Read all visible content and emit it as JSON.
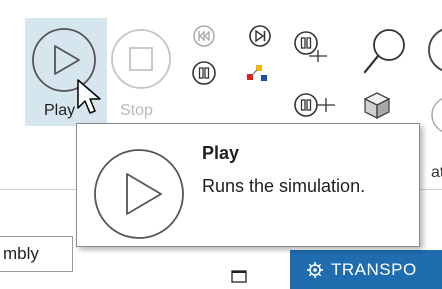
{
  "ribbon": {
    "play_label": "Play",
    "stop_label": "Stop"
  },
  "icons": {
    "play": "play-circle-icon",
    "stop": "stop-circle-icon",
    "jump_start": "jump-to-start-icon",
    "step": "step-forward-icon",
    "pause": "pause-icon",
    "search": "magnifier-icon"
  },
  "tooltip": {
    "title": "Play",
    "description": "Runs the simulation."
  },
  "assembly_combo": {
    "value": "mbly"
  },
  "partial_label": "at",
  "transport_tab": {
    "label": "TRANSPO"
  },
  "colors": {
    "accent": "#1f6cae",
    "hover": "#d6e6ef"
  }
}
